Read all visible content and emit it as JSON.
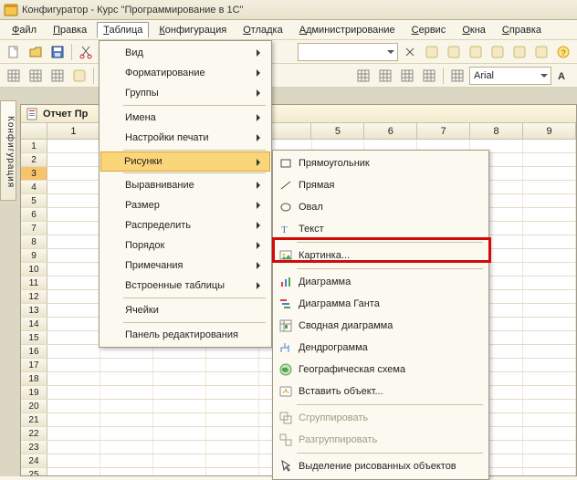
{
  "title": "Конфигуратор - Курс \"Программирование в 1С\"",
  "menubar": [
    "Файл",
    "Правка",
    "Таблица",
    "Конфигурация",
    "Отладка",
    "Администрирование",
    "Сервис",
    "Окна",
    "Справка"
  ],
  "active_menu_index": 2,
  "toolbar2_font": "Arial",
  "side_tab": "Конфигурация",
  "doc_title": "Отчет Пр",
  "columns_left": [
    "1"
  ],
  "columns_right": [
    "5",
    "6",
    "7",
    "8",
    "9"
  ],
  "row_labels": [
    "1",
    "2",
    "3",
    "4",
    "5",
    "6",
    "7",
    "8",
    "9",
    "10",
    "11",
    "12",
    "13",
    "14",
    "15",
    "16",
    "17",
    "18",
    "19",
    "20",
    "21",
    "22",
    "23",
    "24",
    "25"
  ],
  "selected_row": 3,
  "menu1": {
    "items": [
      {
        "label": "Вид",
        "sub": true
      },
      {
        "label": "Форматирование",
        "sub": true
      },
      {
        "label": "Группы",
        "sub": true
      },
      {
        "sep": true
      },
      {
        "label": "Имена",
        "sub": true
      },
      {
        "label": "Настройки печати",
        "sub": true
      },
      {
        "sep": true
      },
      {
        "label": "Рисунки",
        "sub": true,
        "highlight": true
      },
      {
        "sep": true
      },
      {
        "label": "Выравнивание",
        "sub": true
      },
      {
        "label": "Размер",
        "sub": true
      },
      {
        "label": "Распределить",
        "sub": true
      },
      {
        "label": "Порядок",
        "sub": true
      },
      {
        "label": "Примечания",
        "sub": true
      },
      {
        "label": "Встроенные таблицы",
        "sub": true
      },
      {
        "sep": true
      },
      {
        "label": "Ячейки"
      },
      {
        "sep": true
      },
      {
        "label": "Панель редактирования"
      }
    ]
  },
  "menu2": {
    "items": [
      {
        "icon": "rect",
        "label": "Прямоугольник"
      },
      {
        "icon": "line",
        "label": "Прямая"
      },
      {
        "icon": "oval",
        "label": "Овал"
      },
      {
        "icon": "text",
        "label": "Текст"
      },
      {
        "sep": true
      },
      {
        "icon": "picture",
        "label": "Картинка...",
        "callout": true
      },
      {
        "sep": true
      },
      {
        "icon": "chart",
        "label": "Диаграмма"
      },
      {
        "icon": "gantt",
        "label": "Диаграмма Ганта"
      },
      {
        "icon": "pivot",
        "label": "Сводная диаграмма"
      },
      {
        "icon": "dendro",
        "label": "Дендрограмма"
      },
      {
        "icon": "geo",
        "label": "Географическая схема"
      },
      {
        "icon": "ole",
        "label": "Вставить объект..."
      },
      {
        "sep": true
      },
      {
        "icon": "group",
        "label": "Сгруппировать",
        "disabled": true
      },
      {
        "icon": "ungroup",
        "label": "Разгруппировать",
        "disabled": true
      },
      {
        "sep": true
      },
      {
        "icon": "pointer",
        "label": "Выделение рисованных объектов"
      }
    ]
  }
}
